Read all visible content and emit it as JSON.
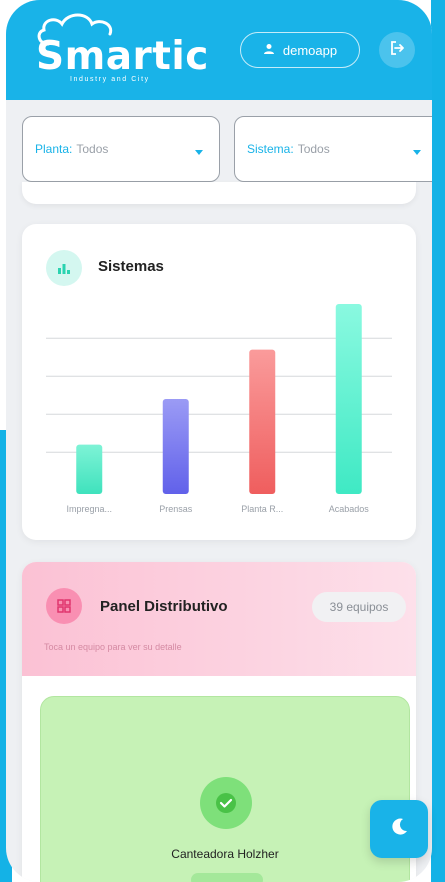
{
  "header": {
    "logo_text": "Smartic",
    "logo_sub": "Industry and City",
    "user_label": "demoapp",
    "logout_icon": "logout-icon"
  },
  "filters": [
    {
      "label": "Planta:",
      "value": "Todos"
    },
    {
      "label": "Sistema:",
      "value": "Todos"
    }
  ],
  "systems_card": {
    "title": "Sistemas",
    "icon": "bar-chart-icon"
  },
  "chart_data": {
    "type": "bar",
    "categories": [
      "Impregna...",
      "Prensas",
      "Planta R...",
      "Acabados"
    ],
    "values": [
      1.3,
      2.5,
      3.8,
      5.0
    ],
    "colors": [
      [
        "#7ef3d6",
        "#3fe2bd"
      ],
      [
        "#9b9bf5",
        "#6161ea"
      ],
      [
        "#fa9b9b",
        "#ef5e5e"
      ],
      [
        "#8af9e0",
        "#3fe9c4"
      ]
    ],
    "ylim": [
      0,
      5
    ],
    "grid": true
  },
  "panel": {
    "title": "Panel Distributivo",
    "count": "39 equipos",
    "subtitle": "Toca un equipo para ver su detalle",
    "icon": "grid-icon"
  },
  "equipment": [
    {
      "name": "Canteadora Holzher",
      "status_icon": "check-icon"
    }
  ],
  "theme_toggle": {
    "icon": "moon-icon"
  },
  "colors": {
    "primary": "#19b3e8",
    "panel_pink": "#fbc1d4",
    "equipment_green": "#c6f2b6"
  }
}
